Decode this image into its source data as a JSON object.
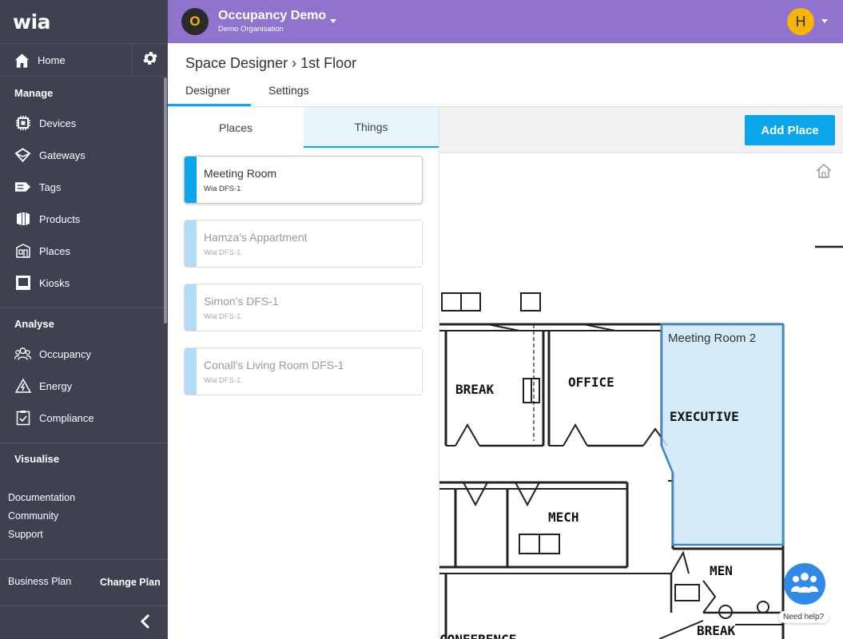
{
  "app": {
    "logo": "wia"
  },
  "sidebar": {
    "home_label": "Home",
    "sections": {
      "manage": "Manage",
      "analyse": "Analyse",
      "visualise": "Visualise"
    },
    "manage_items": [
      {
        "label": "Devices",
        "icon": "devices-icon"
      },
      {
        "label": "Gateways",
        "icon": "gateways-icon"
      },
      {
        "label": "Tags",
        "icon": "tag-icon"
      },
      {
        "label": "Products",
        "icon": "products-icon"
      },
      {
        "label": "Places",
        "icon": "places-icon"
      },
      {
        "label": "Kiosks",
        "icon": "kiosk-icon"
      }
    ],
    "analyse_items": [
      {
        "label": "Occupancy",
        "icon": "occupancy-icon"
      },
      {
        "label": "Energy",
        "icon": "energy-icon"
      },
      {
        "label": "Compliance",
        "icon": "compliance-icon"
      }
    ],
    "links": {
      "documentation": "Documentation",
      "community": "Community",
      "support": "Support"
    },
    "plan": {
      "label": "Business Plan",
      "change": "Change Plan"
    }
  },
  "header": {
    "org_initial": "O",
    "org_name": "Occupancy Demo",
    "org_sub": "Demo Organisation",
    "user_initial": "H"
  },
  "page": {
    "breadcrumb": "Space Designer › 1st Floor",
    "tabs": [
      "Designer",
      "Settings"
    ],
    "active_tab": "Designer"
  },
  "panel": {
    "subtabs": [
      "Places",
      "Things"
    ],
    "places": [
      {
        "name": "Meeting Room",
        "device": "Wia DFS-1",
        "active": true
      },
      {
        "name": "Hamza's Appartment",
        "device": "Wia DFS-1",
        "active": false
      },
      {
        "name": "Simon's DFS-1",
        "device": "Wia DFS-1",
        "active": false
      },
      {
        "name": "Conall's Living Room DFS-1",
        "device": "Wia DFS-1",
        "active": false
      }
    ]
  },
  "designer": {
    "add_place_label": "Add Place",
    "floorplan_labels": {
      "break": "BREAK",
      "office": "OFFICE",
      "executive": "EXECUTIVE",
      "mech": "MECH",
      "men": "MEN",
      "break2": "BREAK",
      "conference": "CONFERENCE"
    },
    "overlay_label": "Meeting Room 2"
  },
  "help": {
    "label": "Need help?"
  },
  "colors": {
    "sidebar_bg": "#3d4150",
    "header_bg": "#8f73cd",
    "accent": "#0ba5ec",
    "org_avatar": "#f7b500"
  }
}
